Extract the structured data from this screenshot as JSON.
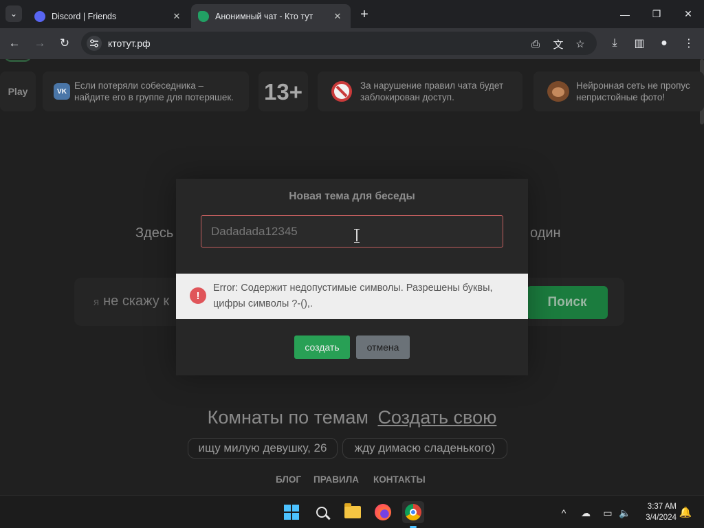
{
  "browser": {
    "tabs": [
      {
        "title": "Discord | Friends",
        "active": false
      },
      {
        "title": "Анонимный чат - Кто тут",
        "active": true
      }
    ],
    "url": "ктотут.рф",
    "colors": {
      "frame": "#202124",
      "toolbar": "#35363a",
      "omnibox": "#282a2d"
    }
  },
  "page": {
    "info_cards": {
      "play": "Play",
      "vk": "Если потеряли собеседника –\nнайдите его в группе для потеряшек.",
      "age": "13+",
      "ban": "За нарушение правил чата будет\nзаблокирован доступ.",
      "ai": "Нейронная сеть не пропус\nнепристойные фото!"
    },
    "hero_left": "Здесь",
    "hero_right": "один",
    "search": {
      "prefix": "я",
      "value": "не скажу к",
      "button": "Поиск"
    },
    "rooms": {
      "title": "Комнаты по темам",
      "create_link": "Создать свою",
      "chips": [
        "ищу милую девушку, 26",
        "жду димасю сладенького)"
      ]
    },
    "footer_links": [
      "БЛОГ",
      "ПРАВИЛА",
      "КОНТАКТЫ"
    ],
    "colors": {
      "background": "#202020",
      "accent_green": "#28a055"
    }
  },
  "modal": {
    "title": "Новая тема для беседы",
    "input_value": "Dadadada12345",
    "create_button": "создать",
    "cancel_button": "отмена",
    "error_message": "Error: Содержит недопустимые символы. Разрешены буквы, цифры символы ?-(),.",
    "colors": {
      "error_border": "#c35f5f",
      "error_icon": "#e0555a"
    }
  },
  "taskbar": {
    "time": "3:37 AM",
    "date": "3/4/2024",
    "apps": [
      "start-icon",
      "search-icon",
      "file-explorer-icon",
      "firefox-icon",
      "chrome-icon"
    ]
  }
}
